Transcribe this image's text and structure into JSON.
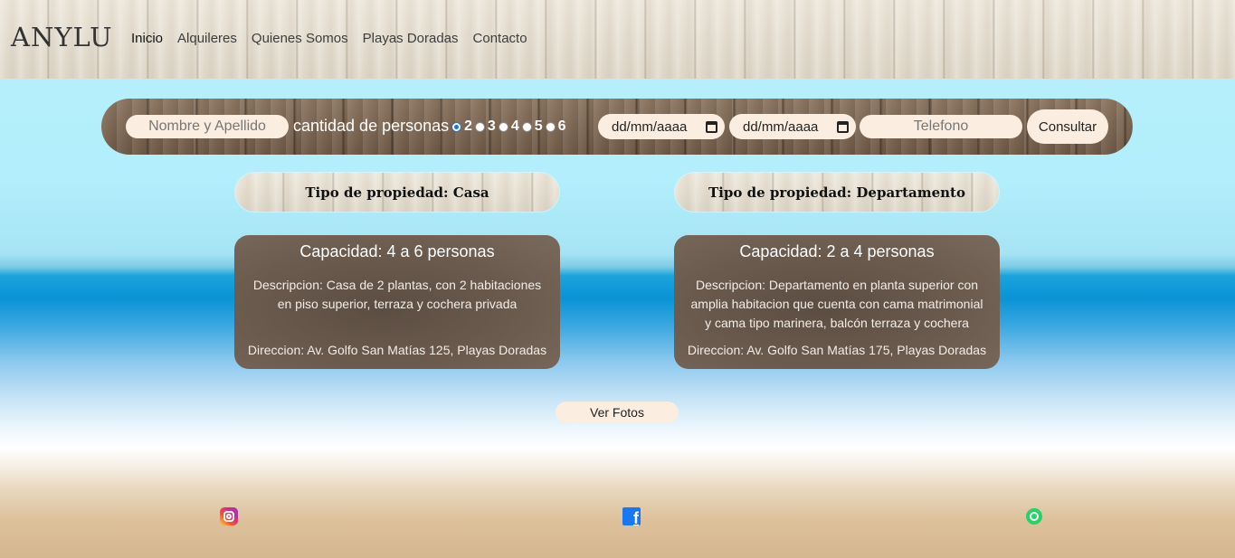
{
  "header": {
    "logo": "ANYLU",
    "nav": [
      {
        "label": "Inicio",
        "active": true
      },
      {
        "label": "Alquileres"
      },
      {
        "label": "Quienes Somos"
      },
      {
        "label": "Playas Doradas"
      },
      {
        "label": "Contacto"
      }
    ]
  },
  "form": {
    "name_placeholder": "Nombre y Apellido",
    "quantity_label": "cantidad de personas",
    "options": [
      "2",
      "3",
      "4",
      "5",
      "6"
    ],
    "selected_option": "2",
    "date_from_placeholder": "dd/mm/aaaa",
    "date_to_placeholder": "dd/mm/aaaa",
    "phone_placeholder": "Telefono",
    "submit_label": "Consultar"
  },
  "properties": [
    {
      "type": "Tipo de propiedad: Casa",
      "capacity": "Capacidad: 4 a 6 personas",
      "description": "Descripcion: Casa de 2 plantas, con 2 habitaciones en piso superior, terraza y cochera privada",
      "address": "Direccion: Av. Golfo San Matías 125, Playas Doradas"
    },
    {
      "type": "Tipo de propiedad: Departamento",
      "capacity": "Capacidad: 2 a 4 personas",
      "description": "Descripcion: Departamento en planta superior con amplia habitacion que cuenta con cama matrimonial y cama tipo marinera, balcón terraza y cochera",
      "address": "Direccion: Av. Golfo San Matías 175, Playas Doradas"
    }
  ],
  "photos_button": "Ver Fotos",
  "social": {
    "instagram_icon": "instagram-icon",
    "facebook_icon": "facebook-icon",
    "facebook_glyph": "f",
    "whatsapp_icon": "whatsapp-icon"
  },
  "colors": {
    "pill_background": "#fbeee0",
    "card_background": "#6b5b4f",
    "radio_accent": "#1a73e8"
  }
}
